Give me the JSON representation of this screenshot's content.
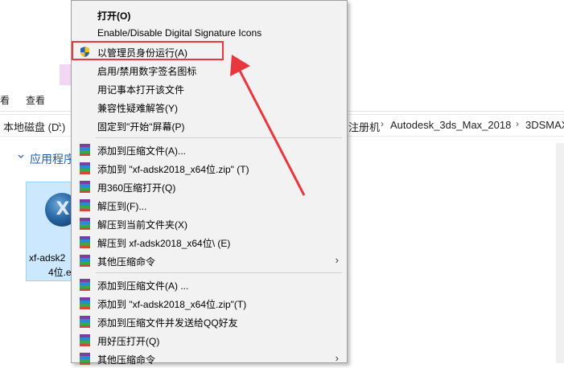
{
  "explorer": {
    "ribbon_tab_left": "看",
    "ribbon_tab_view": "查看",
    "address_drive": "本地磁盘 (D:)",
    "address_crumbs": [
      "注册机",
      "Autodesk_3ds_Max_2018",
      "3DSMAX"
    ],
    "group_header": "应用程序",
    "file_label_line1": "xf-adsk2",
    "file_label_line2": "4位.e"
  },
  "context_menu": {
    "items": [
      {
        "label": "打开(O)",
        "bold": true,
        "icon": "none"
      },
      {
        "label": "Enable/Disable Digital Signature Icons",
        "icon": "none"
      },
      {
        "label": "以管理员身份运行(A)",
        "icon": "uac-shield-icon"
      },
      {
        "label": "启用/禁用数字签名图标",
        "icon": "none"
      },
      {
        "label": "用记事本打开该文件",
        "icon": "none"
      },
      {
        "label": "兼容性疑难解答(Y)",
        "icon": "none"
      },
      {
        "label": "固定到\"开始\"屏幕(P)",
        "icon": "none"
      },
      {
        "label": "添加到压缩文件(A)...",
        "icon": "winrar-icon"
      },
      {
        "label": "添加到 \"xf-adsk2018_x64位.zip\" (T)",
        "icon": "winrar-icon"
      },
      {
        "label": "用360压缩打开(Q)",
        "icon": "winrar-icon"
      },
      {
        "label": "解压到(F)...",
        "icon": "winrar-icon"
      },
      {
        "label": "解压到当前文件夹(X)",
        "icon": "winrar-icon"
      },
      {
        "label": "解压到 xf-adsk2018_x64位\\ (E)",
        "icon": "winrar-icon"
      },
      {
        "label": "其他压缩命令",
        "icon": "winrar-icon",
        "submenu": true
      },
      {
        "label": "添加到压缩文件(A) ...",
        "icon": "winrar-icon"
      },
      {
        "label": "添加到 \"xf-adsk2018_x64位.zip\"(T)",
        "icon": "winrar-icon"
      },
      {
        "label": "添加到压缩文件并发送给QQ好友",
        "icon": "winrar-icon"
      },
      {
        "label": "用好压打开(Q)",
        "icon": "winrar-icon"
      },
      {
        "label": "其他压缩命令",
        "icon": "winrar-icon",
        "submenu": true
      }
    ],
    "submenu_arrow": "›"
  },
  "annotation": {
    "highlight_color": "#e8383d"
  }
}
